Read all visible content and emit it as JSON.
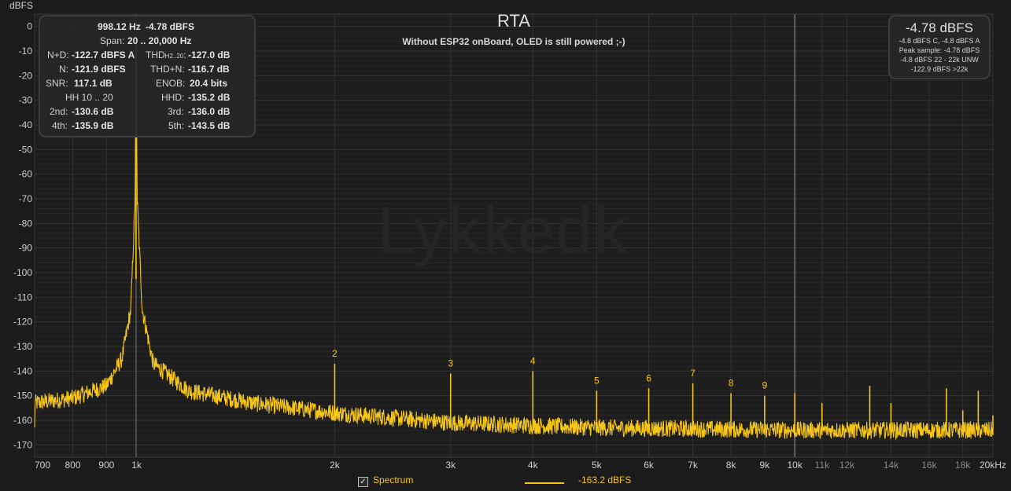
{
  "app": {
    "unit_label": "dBFS",
    "title": "RTA",
    "subtitle": "Without ESP32 onBoard, OLED is still powered ;-)",
    "watermark": "Lykkedk"
  },
  "stats": {
    "freq": "998.12 Hz",
    "level": "-4.78 dBFS",
    "span_label": "Span:",
    "span_value": "20 .. 20,000 Hz",
    "nd_label": "N+D:",
    "nd_value": "-122.7 dBFS A",
    "thd_label_main": "THD",
    "thd_label_sub": "H2..20",
    "thd_label_colon": ":",
    "thd_value": "-127.0 dB",
    "n_label": "N:",
    "n_value": "-121.9 dBFS",
    "thdn_label": "THD+N:",
    "thdn_value": "-116.7 dB",
    "snr_label": "SNR:",
    "snr_value": "117.1 dB",
    "enob_label": "ENOB:",
    "enob_value": "20.4 bits",
    "hh_label": "HH 10 .. 20",
    "hhd_label": "HHD:",
    "hhd_value": "-135.2 dB",
    "h2_label": "2nd:",
    "h2_value": "-130.6 dB",
    "h3_label": "3rd:",
    "h3_value": "-136.0 dB",
    "h4_label": "4th:",
    "h4_value": "-135.9 dB",
    "h5_label": "5th:",
    "h5_value": "-143.5 dB"
  },
  "peak_box": {
    "value": "-4.78 dBFS",
    "line1": "-4.8 dBFS C, -4.8 dBFS A",
    "line2": "Peak sample: -4.78 dBFS",
    "line3": "-4.8 dBFS 22 - 22k UNW",
    "line4": "-122.9 dBFS >22k"
  },
  "legend": {
    "checkbox_mark": "✓",
    "series_label": "Spectrum",
    "cursor_value": "-163.2 dBFS"
  },
  "colors": {
    "background": "#1b1b1b",
    "trace": "#f5c518",
    "grid": "#2c2c2c"
  },
  "chart_data": {
    "type": "line",
    "title": "RTA",
    "subtitle": "Without ESP32 onBoard, OLED is still powered ;-)",
    "ylabel": "dBFS",
    "xscale": "log",
    "xlim": [
      700,
      20000
    ],
    "ylim": [
      -175,
      5
    ],
    "y_ticks": [
      0,
      -10,
      -20,
      -30,
      -40,
      -50,
      -60,
      -70,
      -80,
      -90,
      -100,
      -110,
      -120,
      -130,
      -140,
      -150,
      -160,
      -170
    ],
    "x_ticks": [
      {
        "value": 700,
        "label": "700"
      },
      {
        "value": 800,
        "label": "800"
      },
      {
        "value": 900,
        "label": "900"
      },
      {
        "value": 1000,
        "label": "1k"
      },
      {
        "value": 2000,
        "label": "2k"
      },
      {
        "value": 3000,
        "label": "3k"
      },
      {
        "value": 4000,
        "label": "4k"
      },
      {
        "value": 5000,
        "label": "5k"
      },
      {
        "value": 6000,
        "label": "6k"
      },
      {
        "value": 7000,
        "label": "7k"
      },
      {
        "value": 8000,
        "label": "8k"
      },
      {
        "value": 9000,
        "label": "9k"
      },
      {
        "value": 10000,
        "label": "10k"
      },
      {
        "value": 11000,
        "label": "11k"
      },
      {
        "value": 12000,
        "label": "12k"
      },
      {
        "value": 14000,
        "label": "14k"
      },
      {
        "value": 16000,
        "label": "16k"
      },
      {
        "value": 18000,
        "label": "18k"
      },
      {
        "value": 20000,
        "label": "20kHz"
      }
    ],
    "grid": true,
    "series": [
      {
        "name": "Spectrum",
        "fundamental": {
          "x": 998.12,
          "y": -4.78
        },
        "spectrum_envelope": [
          {
            "x": 700,
            "y": -153
          },
          {
            "x": 800,
            "y": -151
          },
          {
            "x": 900,
            "y": -146
          },
          {
            "x": 950,
            "y": -135
          },
          {
            "x": 980,
            "y": -115
          },
          {
            "x": 995,
            "y": -70
          },
          {
            "x": 998.12,
            "y": -4.78
          },
          {
            "x": 1002,
            "y": -70
          },
          {
            "x": 1020,
            "y": -115
          },
          {
            "x": 1060,
            "y": -137
          },
          {
            "x": 1200,
            "y": -148
          },
          {
            "x": 1500,
            "y": -153
          },
          {
            "x": 2000,
            "y": -157
          },
          {
            "x": 3000,
            "y": -161
          },
          {
            "x": 5000,
            "y": -163
          },
          {
            "x": 10000,
            "y": -164
          },
          {
            "x": 20000,
            "y": -164
          }
        ],
        "harmonics": [
          {
            "label": "2",
            "x": 2000,
            "y": -137
          },
          {
            "label": "3",
            "x": 3000,
            "y": -141
          },
          {
            "label": "4",
            "x": 4000,
            "y": -140
          },
          {
            "label": "5",
            "x": 5000,
            "y": -148
          },
          {
            "label": "6",
            "x": 6000,
            "y": -147
          },
          {
            "label": "7",
            "x": 7000,
            "y": -145
          },
          {
            "label": "8",
            "x": 8000,
            "y": -149
          },
          {
            "label": "9",
            "x": 9000,
            "y": -150
          }
        ],
        "spurs": [
          {
            "x": 10000,
            "y": -149
          },
          {
            "x": 11000,
            "y": -153
          },
          {
            "x": 13000,
            "y": -146
          },
          {
            "x": 14000,
            "y": -153
          },
          {
            "x": 17000,
            "y": -147
          },
          {
            "x": 18000,
            "y": -156
          },
          {
            "x": 19000,
            "y": -148
          },
          {
            "x": 20000,
            "y": -158
          }
        ]
      }
    ],
    "cursor_x": 10000,
    "legend_position": "bottom"
  }
}
